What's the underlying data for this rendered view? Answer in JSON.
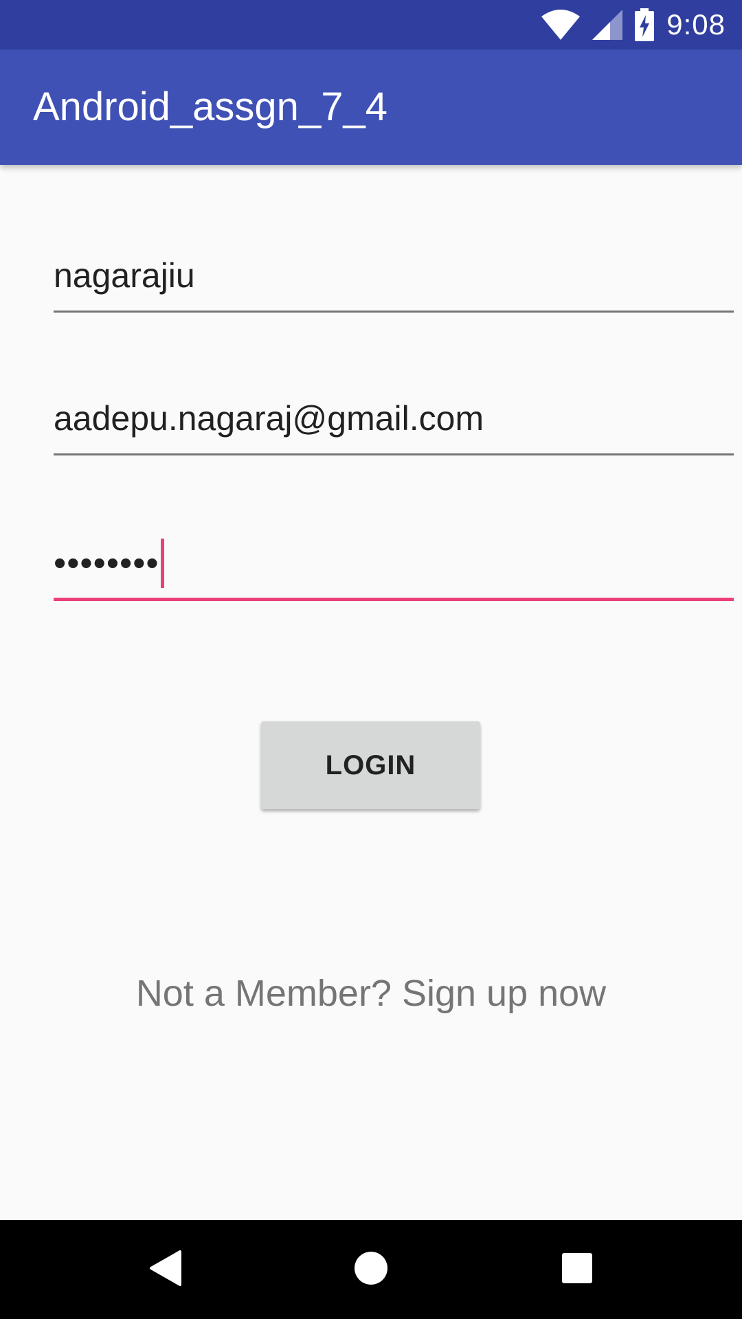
{
  "status_bar": {
    "time": "9:08",
    "icons": [
      "wifi-icon",
      "signal-icon",
      "battery-charging-icon"
    ]
  },
  "app_bar": {
    "title": "Android_assgn_7_4"
  },
  "form": {
    "username_value": "nagarajiu",
    "email_value": "aadepu.nagaraj@gmail.com",
    "password_value": "••••••••",
    "login_label": "LOGIN",
    "signup_text": "Not a Member? Sign up now"
  },
  "nav_bar": {
    "icons": [
      "back-icon",
      "home-icon",
      "recents-icon"
    ]
  },
  "colors": {
    "status_bar": "#303F9F",
    "app_bar": "#3F51B5",
    "accent": "#EC407A",
    "background": "#FAFAFA",
    "button": "#D6D7D7"
  }
}
